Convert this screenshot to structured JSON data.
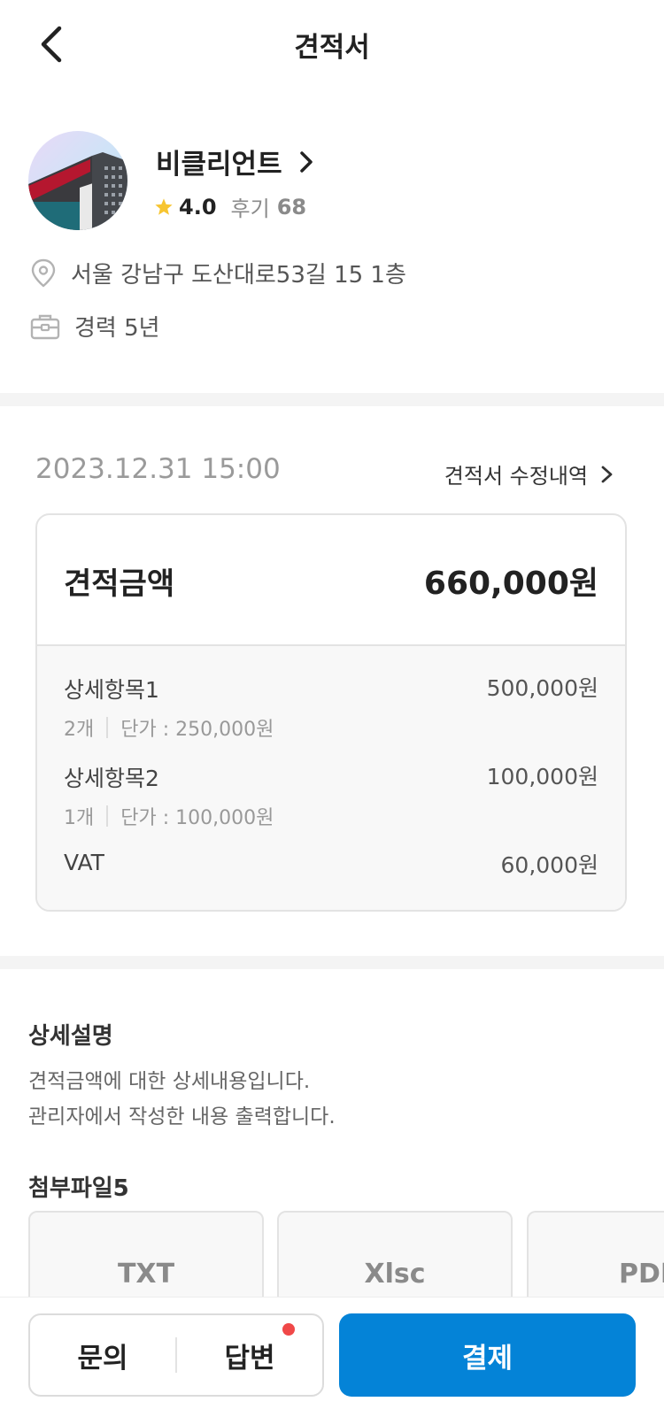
{
  "header": {
    "title": "견적서"
  },
  "vendor": {
    "name": "비클리언트",
    "rating": "4.0",
    "review_label": "후기",
    "review_count": "68",
    "address": "서울 강남구 도산대로53길 15 1층",
    "career": "경력 5년"
  },
  "quote": {
    "date": "2023.12.31 15:00",
    "history_link": "견적서 수정내역",
    "total_label": "견적금액",
    "total_amount": "660,000원",
    "items": [
      {
        "name": "상세항목1",
        "price": "500,000원",
        "qty": "2개",
        "unit_price": "단가 : 250,000원"
      },
      {
        "name": "상세항목2",
        "price": "100,000원",
        "qty": "1개",
        "unit_price": "단가 : 100,000원"
      },
      {
        "name": "VAT",
        "price": "60,000원"
      }
    ]
  },
  "description": {
    "title": "상세설명",
    "lines": [
      "견적금액에 대한 상세내용입니다.",
      "관리자에서 작성한 내용 출력합니다."
    ]
  },
  "attachments": {
    "title": "첨부파일5",
    "files": [
      "TXT",
      "Xlsc",
      "PDF"
    ]
  },
  "bottom": {
    "inquiry": "문의",
    "answer": "답변",
    "pay": "결제",
    "accent_color": "#0483d7",
    "notice_dot_color": "#f04848"
  },
  "icons": {
    "back": "chevron-left-icon",
    "star": "star-icon",
    "location": "location-pin-icon",
    "briefcase": "briefcase-icon",
    "chevron": "chevron-right-icon"
  }
}
